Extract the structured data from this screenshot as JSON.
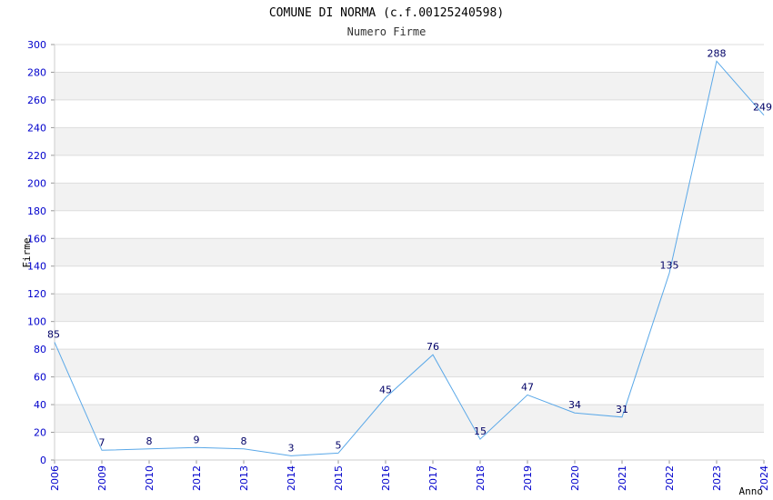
{
  "chart_data": {
    "type": "line",
    "title": "COMUNE DI NORMA (c.f.00125240598)",
    "subtitle": "Numero Firme",
    "xlabel": "Anno",
    "ylabel": "Firme",
    "categories": [
      "2006",
      "2009",
      "2010",
      "2012",
      "2013",
      "2014",
      "2015",
      "2016",
      "2017",
      "2018",
      "2019",
      "2020",
      "2021",
      "2022",
      "2023",
      "2024"
    ],
    "values": [
      85,
      7,
      8,
      9,
      8,
      3,
      5,
      45,
      76,
      15,
      47,
      34,
      31,
      135,
      288,
      249
    ],
    "ylim": [
      0,
      300
    ],
    "yticks": [
      0,
      20,
      40,
      60,
      80,
      100,
      120,
      140,
      160,
      180,
      200,
      220,
      240,
      260,
      280,
      300
    ],
    "grid": true,
    "colors": {
      "line": "#5aa8e8",
      "band": "#f2f2f2",
      "tick_text": "#0000cc",
      "data_label": "#000066"
    }
  }
}
